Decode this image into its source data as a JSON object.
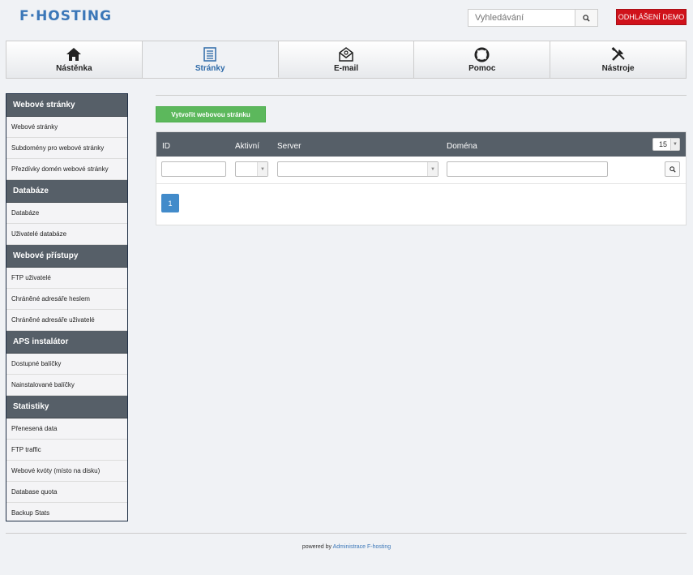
{
  "header": {
    "logo_text": "F·HOSTING",
    "search_placeholder": "Vyhledávání",
    "logout_label": "ODHLÁŠENÍ DEMO"
  },
  "tabs": [
    {
      "label": "Nástěnka",
      "icon": "home-icon",
      "active": false
    },
    {
      "label": "Stránky",
      "icon": "page-list-icon",
      "active": true
    },
    {
      "label": "E-mail",
      "icon": "mail-icon",
      "active": false
    },
    {
      "label": "Pomoc",
      "icon": "lifebuoy-icon",
      "active": false
    },
    {
      "label": "Nástroje",
      "icon": "tools-icon",
      "active": false
    }
  ],
  "sidebar": {
    "sections": [
      {
        "title": "Webové stránky",
        "items": [
          "Webové stránky",
          "Subdomény pro webové stránky",
          "Přezdívky domén webové stránky"
        ]
      },
      {
        "title": "Databáze",
        "items": [
          "Databáze",
          "Uživatelé databáze"
        ]
      },
      {
        "title": "Webové přístupy",
        "items": [
          "FTP uživatelé",
          "Chráněné adresáře heslem",
          "Chráněné adresáře uživatelé"
        ]
      },
      {
        "title": "APS instalátor",
        "items": [
          "Dostupné balíčky",
          "Nainstalované balíčky"
        ]
      },
      {
        "title": "Statistiky",
        "items": [
          "Přenesená data",
          "FTP traffic",
          "Webové kvóty (místo na disku)",
          "Database quota",
          "Backup Stats"
        ]
      }
    ]
  },
  "main": {
    "create_button": "Vytvořit webovou stránku",
    "table": {
      "columns": [
        "ID",
        "Aktivní",
        "Server",
        "Doména"
      ],
      "per_page": "15",
      "current_page": "1"
    }
  },
  "footer": {
    "prefix": "powered by",
    "link": "Administrace F-hosting"
  },
  "colors": {
    "brand": "#3b77b8",
    "logout": "#d0121b",
    "create": "#5cb85c",
    "table_header": "#565f68",
    "pagination": "#428bca"
  }
}
